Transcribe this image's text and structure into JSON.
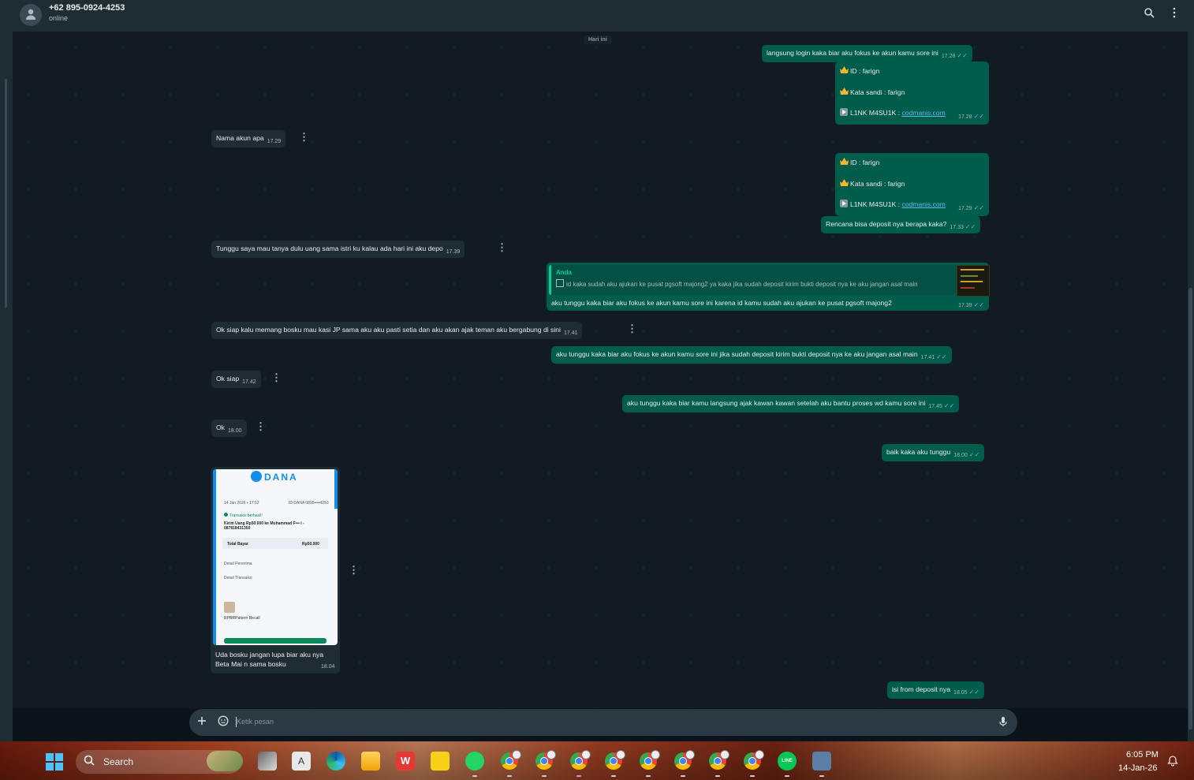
{
  "header": {
    "contact_name": "+62 895-0924-4253",
    "status": "online",
    "icons": [
      "avatar-icon",
      "search-icon",
      "menu-icon"
    ]
  },
  "day_badge": "Hari ini",
  "messages": [
    {
      "dir": "out",
      "text": "langsung login kaka biar aku fokus ke akun kamu sore ini",
      "time": "17.28"
    },
    {
      "dir": "out",
      "lines": [
        "ID :  farign",
        "Kata sandi : farign",
        "L1NK M4SU1K : "
      ],
      "link": "codmanis.com",
      "time": "17.28"
    },
    {
      "dir": "in",
      "text": "Nama akun apa",
      "time": "17.29"
    },
    {
      "dir": "out",
      "lines": [
        "ID :  farign",
        "Kata sandi : farign",
        "L1NK M4SU1K : "
      ],
      "link": "codmanis.com",
      "time": "17.29"
    },
    {
      "dir": "out",
      "text": "Rencana bisa deposit nya berapa kaka?",
      "time": "17.33"
    },
    {
      "dir": "in",
      "text": "Tunggu saya mau tanya dulu uang sama istri ku kalau ada hari ini aku depo",
      "time": "17.39"
    },
    {
      "dir": "out",
      "quote_name": "Anda",
      "quote_text": "id kaka sudah aku ajukan ke pusat pgsoft majong2 ya kaka jika sudah deposit kirim bukti deposit nya ke aku jangan asal main",
      "text": "aku tunggu kaka biar aku fokus ke akun kamu sore ini karena id kamu sudah aku ajukan ke pusat pgsoft majong2",
      "time": "17.39"
    },
    {
      "dir": "in",
      "text": "Ok siap kalu memang bosku mau kasi JP sama aku aku pasti setia dan aku akan ajak teman aku bergabung di sini",
      "time": "17.41"
    },
    {
      "dir": "out",
      "text": "aku tunggu kaka biar aku fokus ke akun kamu sore ini jika sudah deposit kirim bukti deposit nya ke aku jangan asal main",
      "time": "17.41"
    },
    {
      "dir": "in",
      "text": "Ok siap",
      "time": "17.42"
    },
    {
      "dir": "out",
      "text": "aku tunggu kaka biar kamu langsung ajak kawan kawan setelah aku bantu proses wd kamu sore ini",
      "time": "17.45"
    },
    {
      "dir": "in",
      "text": "Ok",
      "time": "18.00"
    },
    {
      "dir": "out",
      "text": "baik kaka aku tunggu",
      "time": "18.00"
    },
    {
      "dir": "in",
      "image": true,
      "caption_lines": [
        "Uda bosku jangan lupa biar aku nya",
        "Beta Mai n sama bosku"
      ],
      "time": "18.04"
    },
    {
      "dir": "out",
      "text": "isi from deposit nya",
      "time": "18.05"
    }
  ],
  "receipt": {
    "brand": "DANA",
    "date": "14 Jan 2026 • 17:52",
    "id": "ID DANA 0895••••4253",
    "status": "Transaksi berhasil!",
    "line1": "Kirim Uang Rp50.000 ke Muhammad F••• i -",
    "line2": "087818431350",
    "total_label": "Total Bayar",
    "total_value": "Rp50.000",
    "detail1": "Detail Penerima",
    "detail2": "Detail Transaksi",
    "promo": "RPRRPattern Recall"
  },
  "input": {
    "placeholder": "Ketik pesan"
  },
  "taskbar": {
    "search_label": "Search",
    "time": "6:05 PM",
    "date": "14-Jan-26"
  }
}
